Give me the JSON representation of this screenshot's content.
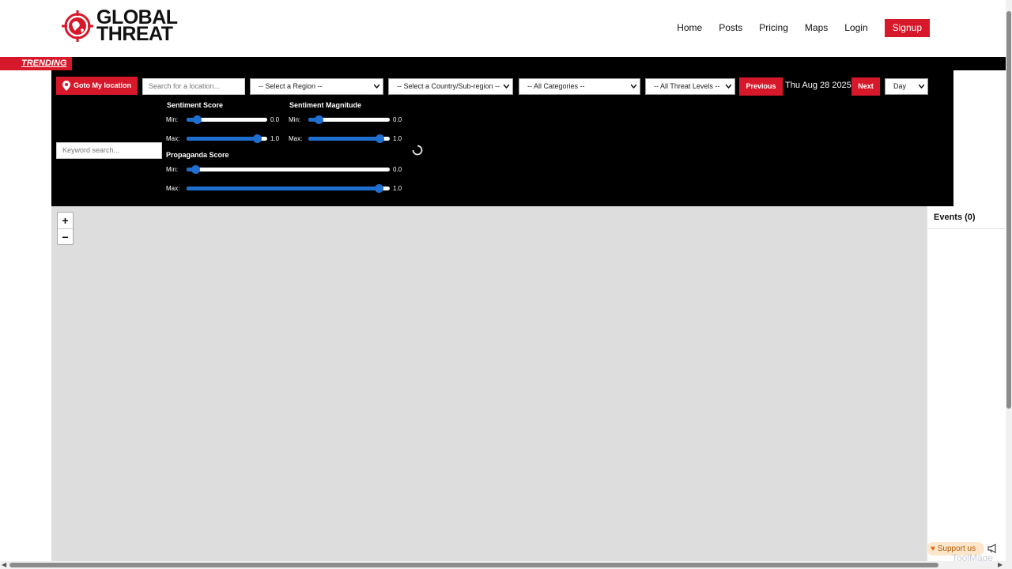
{
  "brand": {
    "line1": "GLOBAL",
    "line2": "THREAT"
  },
  "nav": {
    "items": [
      {
        "label": "Home"
      },
      {
        "label": "Posts"
      },
      {
        "label": "Pricing"
      },
      {
        "label": "Maps"
      },
      {
        "label": "Login"
      }
    ],
    "signup_label": "Signup"
  },
  "trending": {
    "label": "TRENDING"
  },
  "filters": {
    "goto_label": "Goto My location",
    "location_placeholder": "Search for a location...",
    "keyword_placeholder": "Keyword search...",
    "region": "-- Select a Region --",
    "country": "-- Select a Country/Sub-region --",
    "category": "-- All Categories --",
    "threat_level": "-- All Threat Levels --",
    "previous_label": "Previous",
    "date": "Thu Aug 28 2025",
    "next_label": "Next",
    "period": "Day"
  },
  "sliders": {
    "min_label": "Min:",
    "max_label": "Max:",
    "sentiment_score": {
      "title": "Sentiment Score",
      "min": "0.0",
      "max": "1.0"
    },
    "sentiment_magnitude": {
      "title": "Sentiment Magnitude",
      "min": "0.0",
      "max": "1.0"
    },
    "propaganda_score": {
      "title": "Propaganda Score",
      "min": "0.0",
      "max": "1.0"
    }
  },
  "map": {
    "zoom_in": "+",
    "zoom_out": "−"
  },
  "events": {
    "title": "Events (0)"
  },
  "footer": {
    "support_label": "Support us",
    "watermark": "ToolMage"
  },
  "colors": {
    "brand_red": "#d7182a",
    "panel_black": "#000000",
    "slider_blue": "#1f6fd1",
    "map_bg": "#dddddd"
  },
  "icons": [
    "globe-target-icon",
    "location-pin-icon",
    "chevron-down-icon",
    "spinner-icon",
    "heart-icon",
    "megaphone-icon"
  ]
}
